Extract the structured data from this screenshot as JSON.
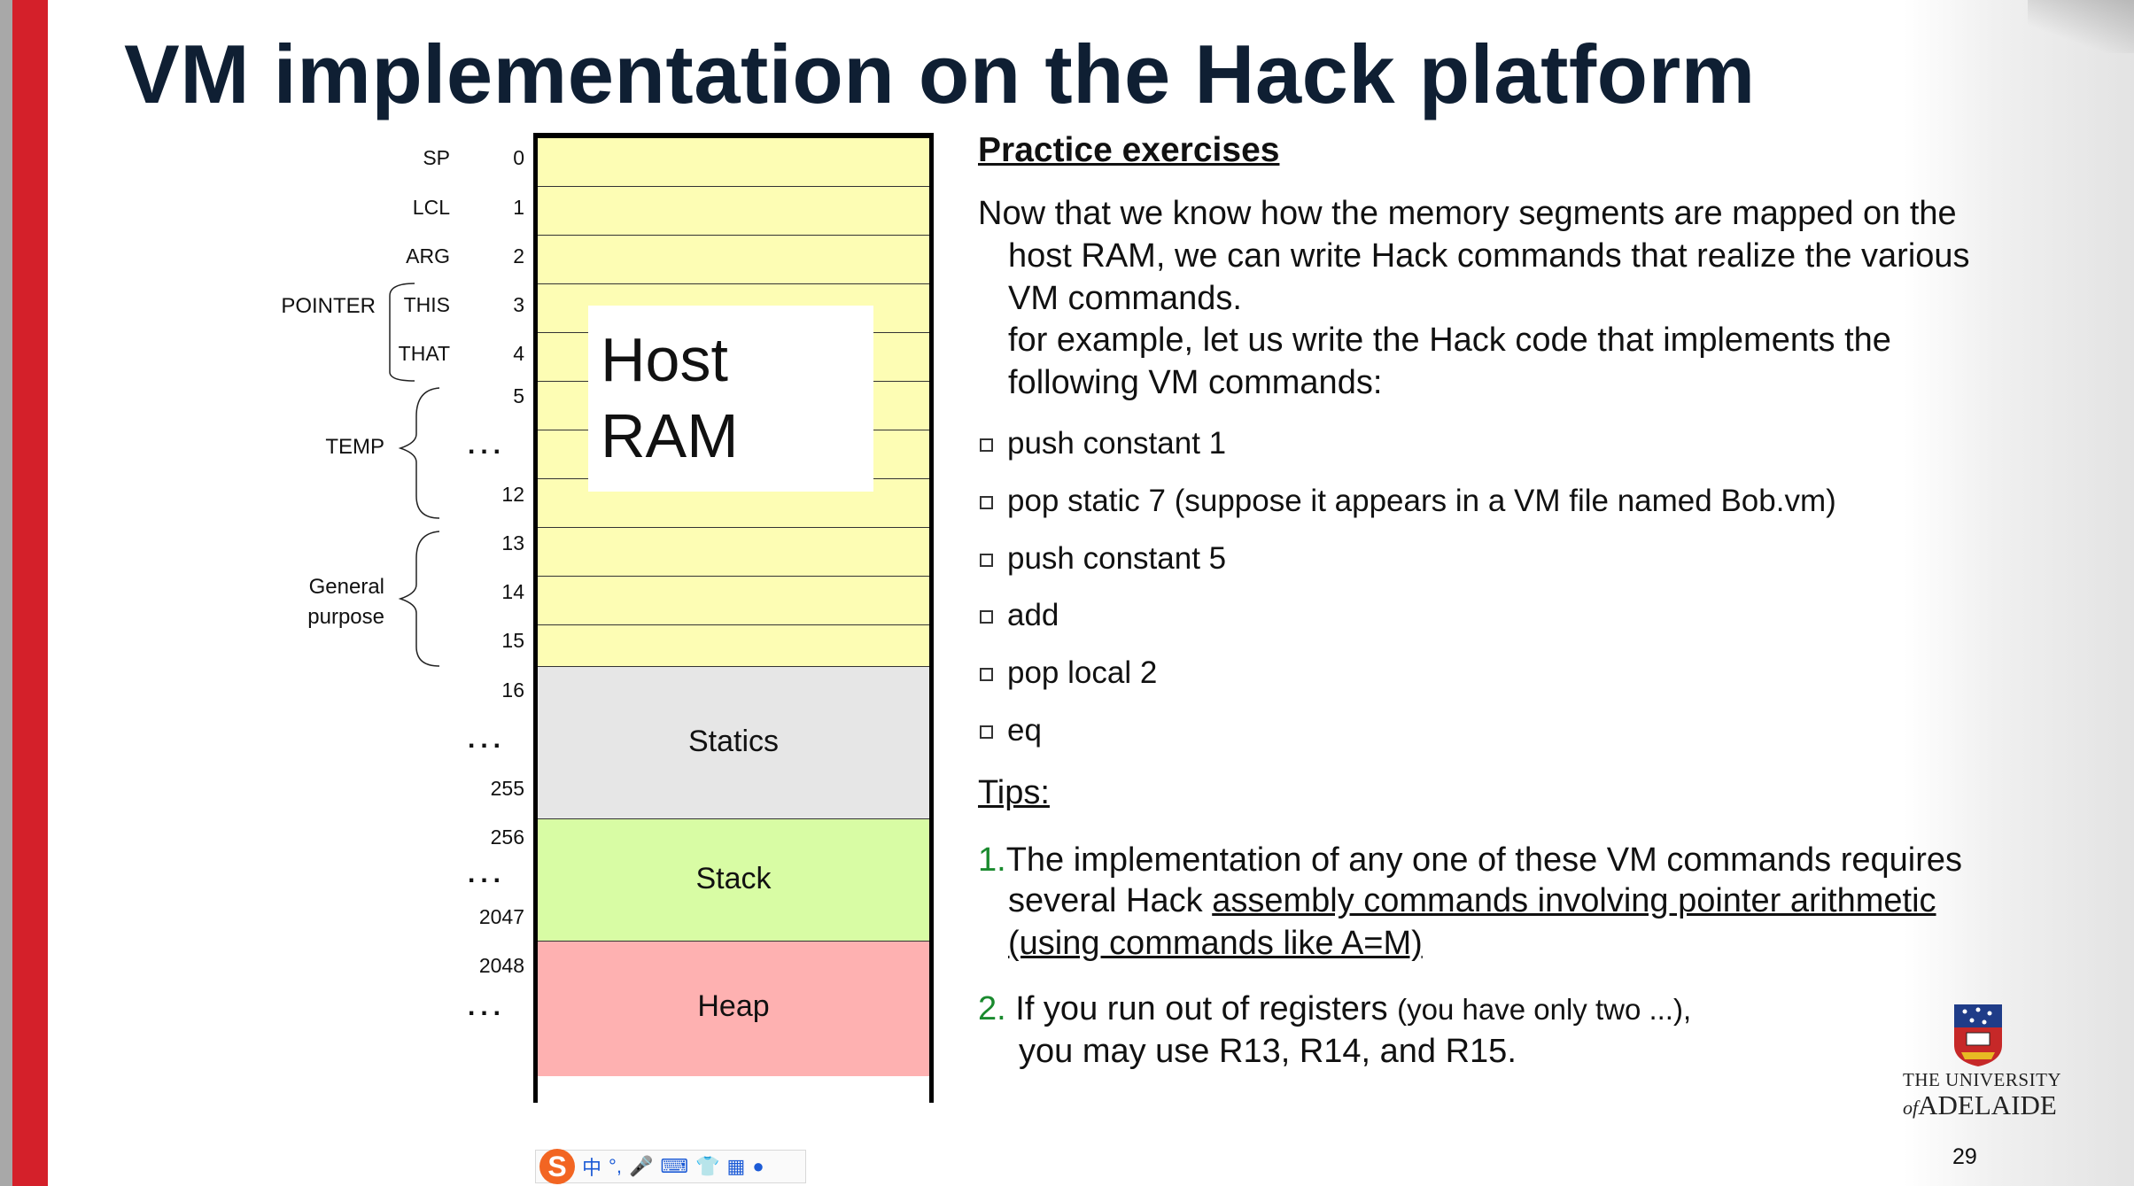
{
  "title": "VM implementation on the Hack platform",
  "ram": {
    "host_label_1": "Host",
    "host_label_2": "RAM",
    "segments": {
      "statics": "Statics",
      "stack": "Stack",
      "heap": "Heap"
    },
    "addresses": [
      "0",
      "1",
      "2",
      "3",
      "4",
      "5",
      "12",
      "13",
      "14",
      "15",
      "16",
      "255",
      "256",
      "2047",
      "2048"
    ],
    "registers": [
      "SP",
      "LCL",
      "ARG",
      "THIS",
      "THAT"
    ],
    "groups": {
      "pointer": "POINTER",
      "temp": "TEMP",
      "general_1": "General",
      "general_2": "purpose"
    },
    "dots": "..."
  },
  "content": {
    "heading": "Practice exercises",
    "intro": [
      "Now that we know how the memory segments are mapped on the",
      "host RAM, we can write Hack commands that realize the various",
      "VM commands.",
      "for example, let us write the Hack code that implements the",
      "following VM commands:"
    ],
    "bullets": [
      "push constant 1",
      "pop static 7 (suppose it appears in a VM file named Bob.vm)",
      "push constant 5",
      "add",
      "pop local 2",
      "eq"
    ],
    "tips_heading": "Tips:",
    "tip1": {
      "num": "1.",
      "line1": "The implementation of any one of these VM commands requires",
      "line2_plain": "several Hack ",
      "line2_ul": "assembly commands involving pointer arithmetic",
      "line3_ul": "(using commands like A=M)"
    },
    "tip2": {
      "num": "2.",
      "line1_a": " If you run out of registers ",
      "line1_b": "(you have only two ...),",
      "line2": "you may use R13, R14, and R15."
    }
  },
  "logo": {
    "line1": "THE UNIVERSITY",
    "line2_a": "of",
    "line2_b": "ADELAIDE"
  },
  "page_number": "29",
  "ime": {
    "lang": "中"
  }
}
